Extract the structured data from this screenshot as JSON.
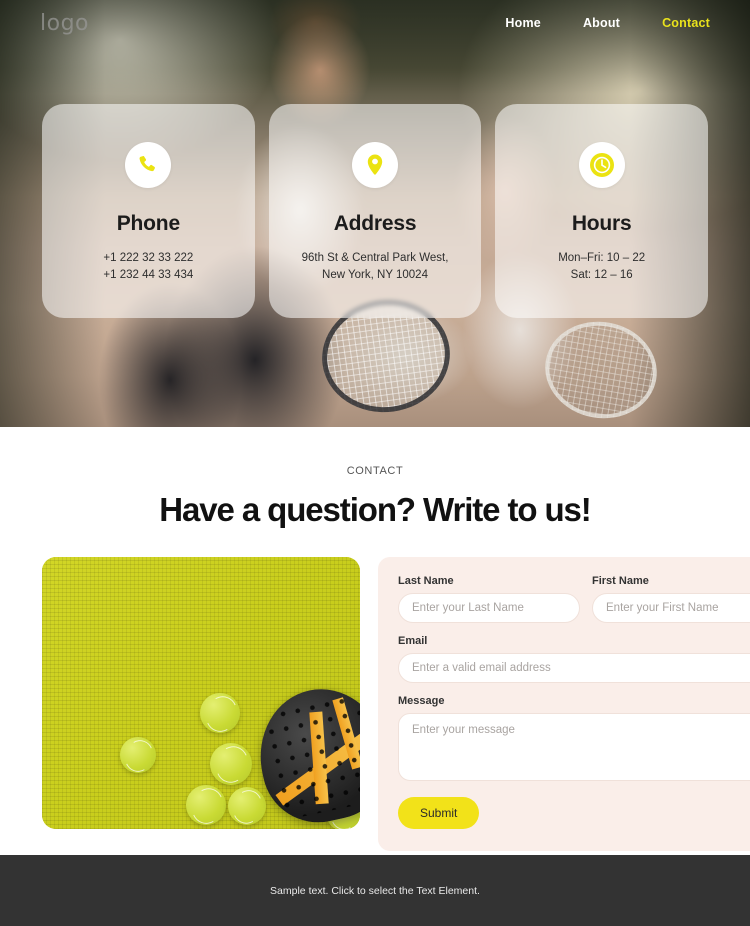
{
  "nav": {
    "logo": "logo",
    "links": [
      {
        "label": "Home",
        "active": false
      },
      {
        "label": "About",
        "active": false
      },
      {
        "label": "Contact",
        "active": true
      }
    ]
  },
  "hero": {
    "cards": [
      {
        "icon": "phone-icon",
        "title": "Phone",
        "lines": [
          "+1 222 32 33 222",
          "+1 232 44 33 434"
        ]
      },
      {
        "icon": "map-pin-icon",
        "title": "Address",
        "lines": [
          "96th St & Central Park West,",
          "New York, NY 10024"
        ]
      },
      {
        "icon": "clock-icon",
        "title": "Hours",
        "lines": [
          "Mon–Fri: 10 – 22",
          "Sat: 12 – 16"
        ]
      }
    ]
  },
  "contact": {
    "eyebrow": "CONTACT",
    "headline": "Have a question? Write to us!",
    "form": {
      "last_name": {
        "label": "Last Name",
        "placeholder": "Enter your Last Name",
        "value": ""
      },
      "first_name": {
        "label": "First Name",
        "placeholder": "Enter your First Name",
        "value": ""
      },
      "email": {
        "label": "Email",
        "placeholder": "Enter a valid email address",
        "value": ""
      },
      "message": {
        "label": "Message",
        "placeholder": "Enter your message",
        "value": ""
      },
      "submit_label": "Submit"
    }
  },
  "footer": {
    "text": "Sample text. Click to select the Text Element."
  },
  "colors": {
    "accent_yellow": "#f2e219",
    "nav_active": "#e9e21c",
    "form_panel_bg": "#faeee9",
    "footer_bg": "#333333"
  }
}
